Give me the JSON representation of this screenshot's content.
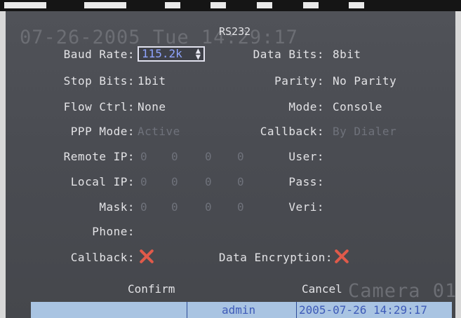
{
  "osd": {
    "watermark_datetime": "07-26-2005 Tue 14:29:17",
    "watermark_camera": "Camera 01",
    "title": "RS232",
    "fields": {
      "baud_rate": {
        "label": "Baud Rate:",
        "value": "115.2k"
      },
      "data_bits": {
        "label": "Data Bits:",
        "value": "8bit"
      },
      "stop_bits": {
        "label": "Stop Bits:",
        "value": "1bit"
      },
      "parity": {
        "label": "Parity:",
        "value": "No Parity"
      },
      "flow_ctrl": {
        "label": "Flow Ctrl:",
        "value": "None"
      },
      "mode": {
        "label": "Mode:",
        "value": "Console"
      },
      "ppp_mode": {
        "label": "PPP Mode:",
        "value": "Active"
      },
      "callback_type": {
        "label": "Callback:",
        "value": "By Dialer"
      },
      "remote_ip": {
        "label": "Remote IP:",
        "octets": [
          "0",
          "0",
          "0",
          "0"
        ]
      },
      "local_ip": {
        "label": "Local IP:",
        "octets": [
          "0",
          "0",
          "0",
          "0"
        ]
      },
      "mask": {
        "label": "Mask:",
        "octets": [
          "0",
          "0",
          "0",
          "0"
        ]
      },
      "user": {
        "label": "User:"
      },
      "pass": {
        "label": "Pass:"
      },
      "veri": {
        "label": "Veri:"
      },
      "phone": {
        "label": "Phone:"
      },
      "callback_check": {
        "label": "Callback:",
        "checked": false
      },
      "data_encryption": {
        "label": "Data Encryption:",
        "checked": false
      }
    },
    "buttons": {
      "confirm": "Confirm",
      "cancel": "Cancel"
    },
    "status": {
      "user": "admin",
      "datetime": "2005-07-26 14:29:17"
    },
    "colors": {
      "background": "#4a4c52",
      "text": "#e3e3e6",
      "disabled": "#6f727b",
      "accent": "#8fa4ff",
      "x_mark": "#e05a4a",
      "statusbar": "#a9c4e2"
    }
  }
}
